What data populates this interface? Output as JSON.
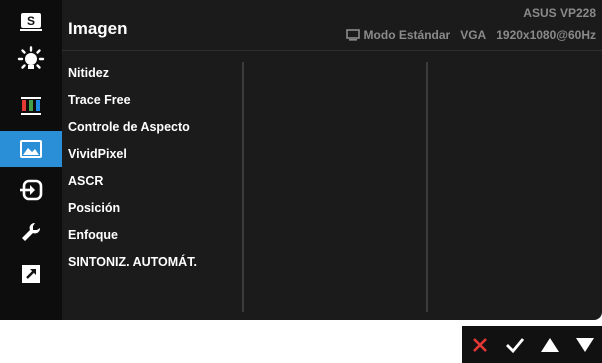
{
  "header": {
    "title": "Imagen",
    "model": "ASUS  VP228",
    "mode": "Modo Estándar",
    "input": "VGA",
    "resolution": "1920x1080@60Hz"
  },
  "sidebar": {
    "items": [
      {
        "name": "splendid",
        "icon": "s-badge-icon",
        "glyph": "S",
        "active": false
      },
      {
        "name": "blue-light",
        "icon": "sun-icon",
        "active": false
      },
      {
        "name": "color",
        "icon": "color-bars-icon",
        "active": false
      },
      {
        "name": "image",
        "icon": "image-icon",
        "active": true
      },
      {
        "name": "input-select",
        "icon": "input-select-icon",
        "active": false
      },
      {
        "name": "system-setup",
        "icon": "wrench-icon",
        "active": false
      },
      {
        "name": "shortcut",
        "icon": "shortcut-arrow-icon",
        "active": false
      }
    ]
  },
  "menu": {
    "items": [
      "Nitidez",
      "Trace Free",
      "Controle de Aspecto",
      "VividPixel",
      "ASCR",
      "Posición",
      "Enfoque",
      "SINTONIZ. AUTOMÁT."
    ]
  },
  "nav": {
    "buttons": [
      {
        "name": "close",
        "icon": "close-icon",
        "color": "#e53935"
      },
      {
        "name": "confirm",
        "icon": "check-icon",
        "color": "#ffffff"
      },
      {
        "name": "up",
        "icon": "triangle-up-icon",
        "color": "#ffffff"
      },
      {
        "name": "down",
        "icon": "triangle-down-icon",
        "color": "#ffffff"
      }
    ]
  },
  "colors": {
    "accent": "#2a8fd6",
    "osd_background": "#1b1b1b",
    "sidebar_background": "#0d0d0d",
    "text": "#ffffff",
    "muted_text": "#8a8a8a"
  }
}
